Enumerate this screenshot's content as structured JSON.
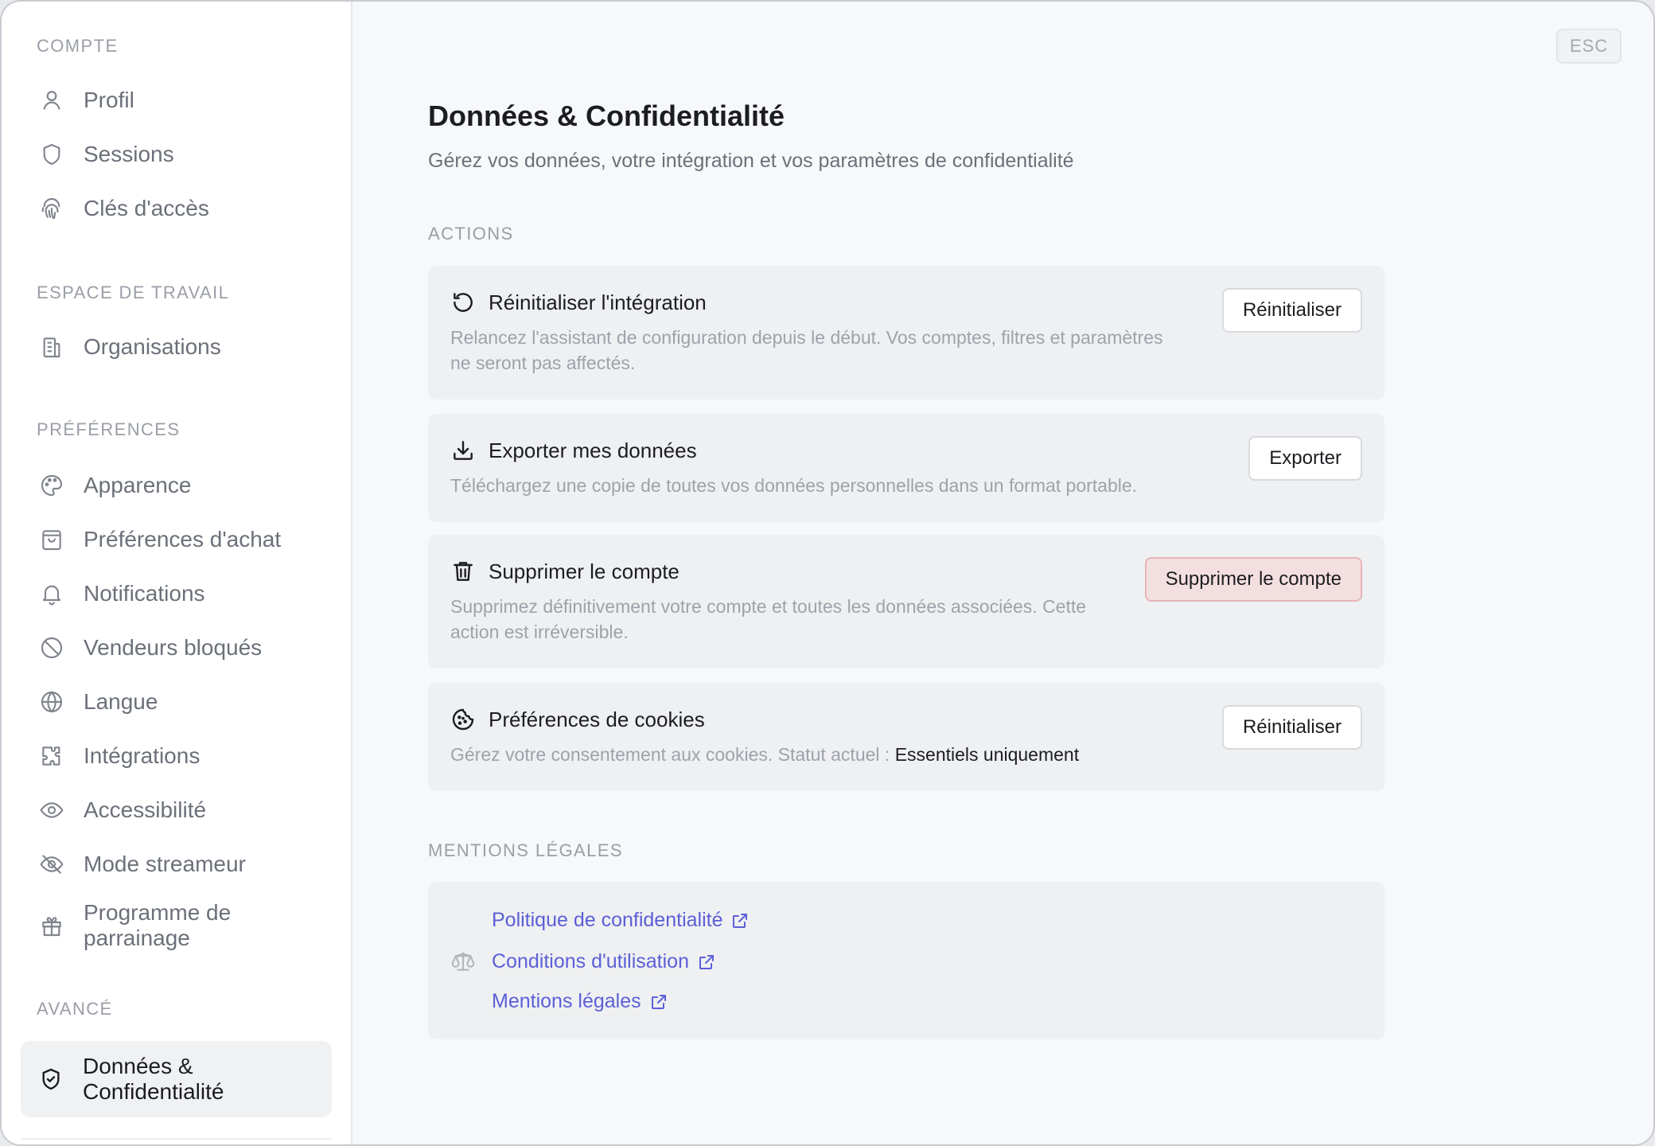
{
  "sidebar": {
    "groups": {
      "compte": "COMPTE",
      "espace": "ESPACE DE TRAVAIL",
      "preferences": "PRÉFÉRENCES",
      "avance": "AVANCÉ"
    },
    "items": {
      "profil": "Profil",
      "sessions": "Sessions",
      "cles": "Clés d'accès",
      "organisations": "Organisations",
      "apparence": "Apparence",
      "achat": "Préférences d'achat",
      "notifications": "Notifications",
      "vendeurs": "Vendeurs bloqués",
      "langue": "Langue",
      "integrations": "Intégrations",
      "accessibilite": "Accessibilité",
      "streameur": "Mode streameur",
      "parrainage_1": "Programme de",
      "parrainage_2": "parrainage",
      "donnees_1": "Données &",
      "donnees_2": "Confidentialité"
    }
  },
  "header": {
    "esc": "ESC",
    "title": "Données & Confidentialité",
    "subtitle": "Gérez vos données, votre intégration et vos paramètres de confidentialité"
  },
  "actions": {
    "label": "ACTIONS",
    "reset": {
      "title": "Réinitialiser l'intégration",
      "desc_1": "Relancez l'assistant de configuration depuis le début. Vos comptes, filtres et paramètres",
      "desc_2": "ne seront pas affectés.",
      "button": "Réinitialiser"
    },
    "export": {
      "title": "Exporter mes données",
      "desc": "Téléchargez une copie de toutes vos données personnelles dans un format portable.",
      "button": "Exporter"
    },
    "delete": {
      "title": "Supprimer le compte",
      "desc_1": "Supprimez définitivement votre compte et toutes les données associées. Cette",
      "desc_2": "action est irréversible.",
      "button": "Supprimer le compte"
    },
    "cookies": {
      "title": "Préférences de cookies",
      "desc": "Gérez votre consentement aux cookies. Statut actuel : ",
      "status": "Essentiels uniquement",
      "button": "Réinitialiser"
    }
  },
  "legal": {
    "label": "MENTIONS LÉGALES",
    "links": {
      "privacy": "Politique de confidentialité",
      "terms": "Conditions d'utilisation",
      "mentions": "Mentions légales"
    }
  },
  "colors": {
    "link": "#5b5fd6",
    "danger_bg": "#f4dfe0",
    "active_bg": "#f0f1f3"
  }
}
